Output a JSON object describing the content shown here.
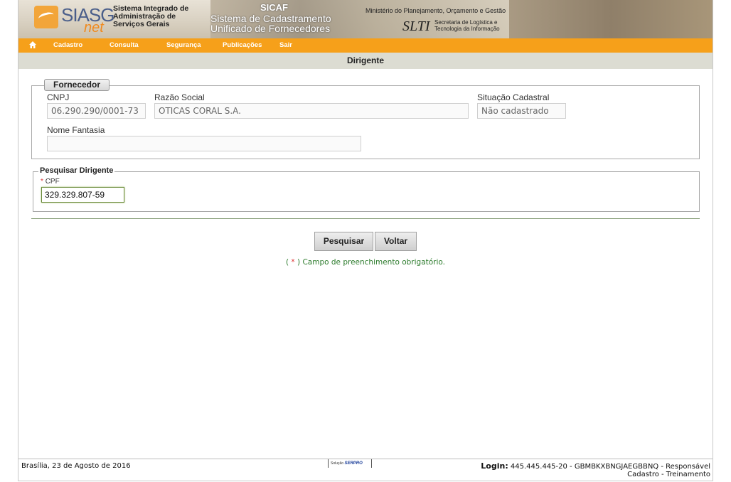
{
  "header": {
    "logo_text": "SIASG",
    "logo_net": "net",
    "system_name_lines": [
      "Sistema Integrado de",
      "Administração de",
      "Serviços Gerais"
    ],
    "sicaf_title": "SICAF",
    "sicaf_subtitle_lines": [
      "Sistema de Cadastramento",
      "Unificado de Fornecedores"
    ],
    "ministerio": "Ministério do Planejamento, Orçamento e Gestão",
    "slti_logo": "SLTI",
    "slti_text_lines": [
      "Secretaria de Logística e",
      "Tecnologia da Informação"
    ]
  },
  "menu": {
    "home_icon": "home-icon",
    "items": [
      "Cadastro",
      "Consulta",
      "Segurança",
      "Publicações",
      "Sair"
    ]
  },
  "page_title": "Dirigente",
  "fornecedor": {
    "legend": "Fornecedor",
    "cnpj_label": "CNPJ",
    "cnpj_value": "06.290.290/0001-73",
    "razao_label": "Razão Social",
    "razao_value": "OTICAS CORAL S.A.",
    "situacao_label": "Situação Cadastral",
    "situacao_value": "Não cadastrado",
    "nome_fantasia_label": "Nome Fantasia",
    "nome_fantasia_value": ""
  },
  "pesquisar": {
    "legend": "Pesquisar Dirigente",
    "required_mark": "*",
    "cpf_label": "CPF",
    "cpf_value": "329.329.807-59"
  },
  "buttons": {
    "pesquisar": "Pesquisar",
    "voltar": "Voltar"
  },
  "note": {
    "prefix": "( ",
    "star": "*",
    "text": " ) Campo de preenchimento obrigatório."
  },
  "footer": {
    "date": "Brasília, 23 de Agosto de 2016",
    "serpro_small": "Solução",
    "serpro_brand": "SERPRO",
    "login_label": "Login:",
    "login_value": " 445.445.445-20 - GBMBKXBNGJAEGBBNQ - Responsável",
    "login_line2": "Cadastro - Treinamento"
  }
}
